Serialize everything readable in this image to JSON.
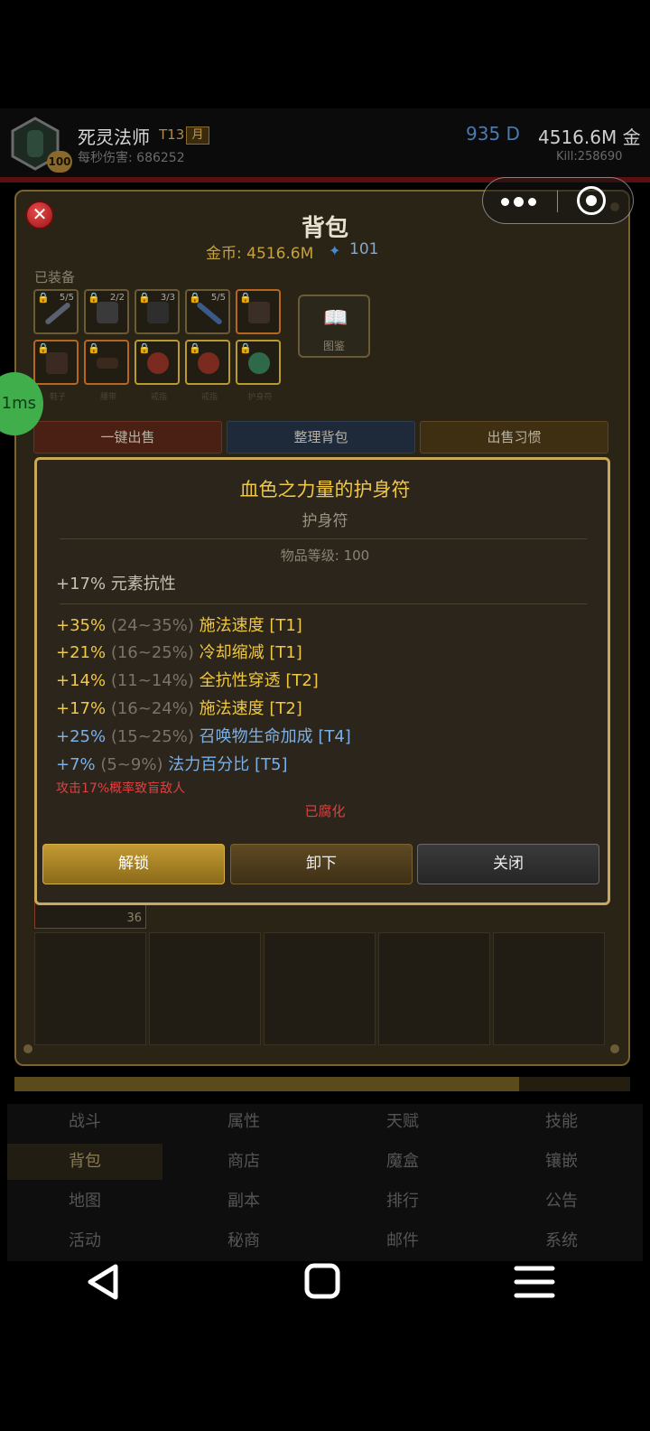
{
  "header": {
    "class_name": "死灵法师",
    "tier": "T13",
    "month_badge": "月",
    "level": "100",
    "dps": "每秒伤害: 686252",
    "diamonds": "935 D",
    "gold": "4516.6M 金",
    "kills": "Kill:258690"
  },
  "bag": {
    "title": "背包",
    "gold": "金币: 4516.6M",
    "diamond_count": "101",
    "equipped_label": "已装备",
    "codex_label": "图鉴",
    "slots_row1": [
      {
        "count": "5/5",
        "icon": "sword-icon"
      },
      {
        "count": "2/2",
        "icon": "helmet-icon"
      },
      {
        "count": "3/3",
        "icon": "armor-icon"
      },
      {
        "count": "5/5",
        "icon": "staff-icon"
      },
      {
        "count": "",
        "icon": "gloves-icon"
      }
    ],
    "slots_row2": [
      {
        "caption": "鞋子",
        "icon": "boots-icon"
      },
      {
        "caption": "腰带",
        "icon": "belt-icon"
      },
      {
        "caption": "戒指",
        "icon": "ring-icon"
      },
      {
        "caption": "戒指",
        "icon": "ring-icon"
      },
      {
        "caption": "护身符",
        "icon": "amulet-icon"
      }
    ],
    "actions": {
      "sell_all": "一键出售",
      "sort": "整理背包",
      "sell_habit": "出售习惯"
    },
    "cell_badge": "36"
  },
  "latency": "1ms",
  "tooltip": {
    "name": "血色之力量的护身符",
    "type": "护身符",
    "item_level": "物品等级: 100",
    "implicit": "+17% 元素抗性",
    "affixes": [
      {
        "value": "+35%",
        "range": "(24~35%)",
        "stat": "施法速度 [T1]",
        "color": "yellow"
      },
      {
        "value": "+21%",
        "range": "(16~25%)",
        "stat": "冷却缩减 [T1]",
        "color": "yellow"
      },
      {
        "value": "+14%",
        "range": "(11~14%)",
        "stat": "全抗性穿透 [T2]",
        "color": "yellow"
      },
      {
        "value": "+17%",
        "range": "(16~24%)",
        "stat": "施法速度 [T2]",
        "color": "yellow"
      },
      {
        "value": "+25%",
        "range": "(15~25%)",
        "stat": "召唤物生命加成 [T4]",
        "color": "blue"
      },
      {
        "value": "+7%",
        "range": "(5~9%)",
        "stat": "法力百分比 [T5]",
        "color": "blue"
      }
    ],
    "special": "攻击17%概率致盲敌人",
    "corrupted": "已腐化",
    "buttons": {
      "unlock": "解锁",
      "unequip": "卸下",
      "close": "关闭"
    }
  },
  "bottom_nav": [
    [
      "战斗",
      "属性",
      "天赋",
      "技能"
    ],
    [
      "背包",
      "商店",
      "魔盒",
      "镶嵌"
    ],
    [
      "地图",
      "副本",
      "排行",
      "公告"
    ],
    [
      "活动",
      "秘商",
      "邮件",
      "系统"
    ]
  ],
  "progress_fraction": 0.82,
  "colors": {
    "rarity_yellow": "#f0c842",
    "magic_blue": "#7ab0e8",
    "corrupt_red": "#e04040",
    "frame_gold": "#c8a85a"
  }
}
